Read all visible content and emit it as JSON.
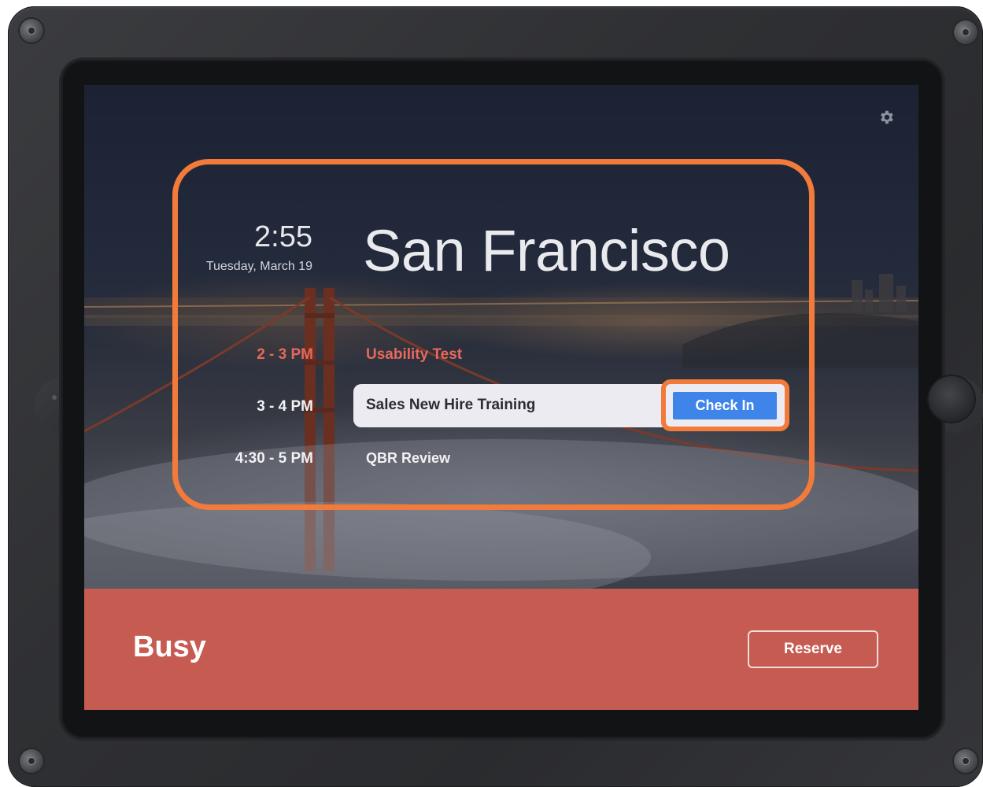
{
  "room_name": "San Francisco",
  "clock": {
    "time": "2:55",
    "date": "Tuesday, March 19"
  },
  "schedule": [
    {
      "time": "2 - 3 PM",
      "title": "Usability Test",
      "state": "past"
    },
    {
      "time": "3 - 4 PM",
      "title": "Sales New Hire Training",
      "state": "current",
      "action_label": "Check In"
    },
    {
      "time": "4:30 - 5 PM",
      "title": "QBR Review",
      "state": "upcoming"
    }
  ],
  "status": {
    "label": "Busy",
    "action_label": "Reserve"
  },
  "icons": {
    "settings": "gear-icon"
  },
  "colors": {
    "busy_bar": "#c55b51",
    "highlight": "#f27a3a",
    "check_in_button": "#3f84e8",
    "past_event": "#e8685a"
  }
}
